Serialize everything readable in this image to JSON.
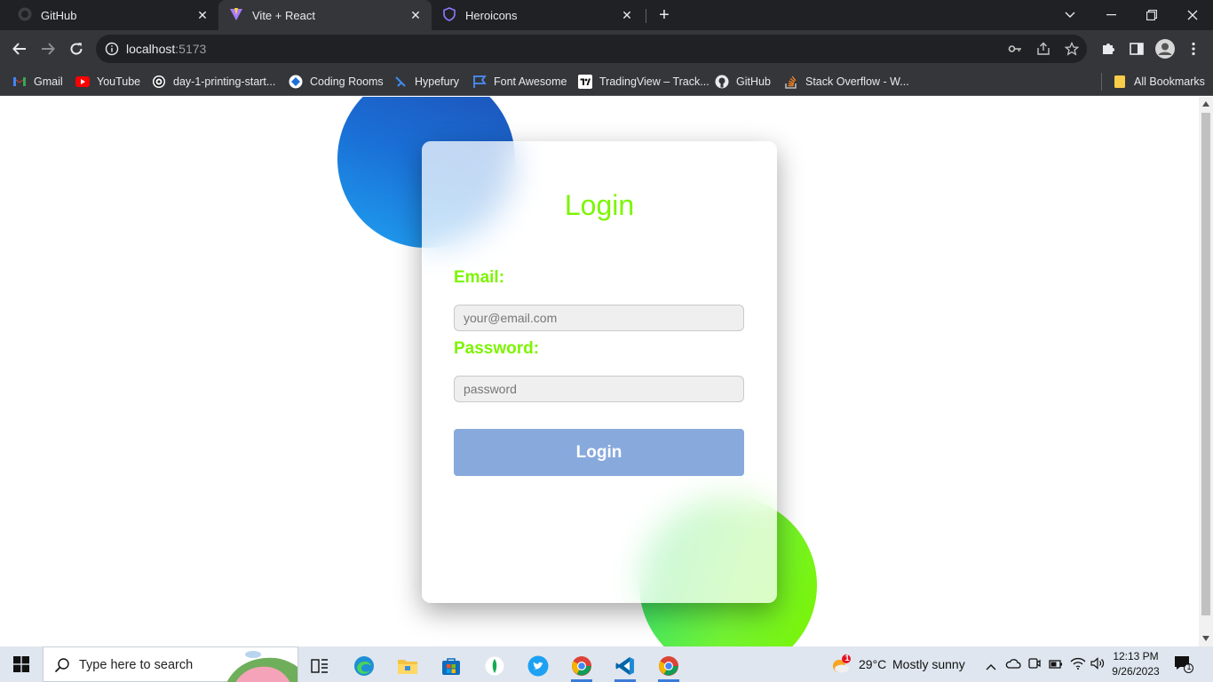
{
  "browser": {
    "tabs": [
      {
        "title": "GitHub",
        "icon": "github-icon"
      },
      {
        "title": "Vite + React",
        "icon": "vite-icon"
      },
      {
        "title": "Heroicons",
        "icon": "heroicons-icon"
      }
    ],
    "address": {
      "host": "localhost",
      "port": ":5173"
    },
    "bookmarks": [
      {
        "label": "Gmail",
        "icon": "gmail-icon"
      },
      {
        "label": "YouTube",
        "icon": "youtube-icon"
      },
      {
        "label": "day-1-printing-start...",
        "icon": "circle-icon"
      },
      {
        "label": "Coding Rooms",
        "icon": "coding-rooms-icon"
      },
      {
        "label": "Hypefury",
        "icon": "hypefury-icon"
      },
      {
        "label": "Font Awesome",
        "icon": "flag-icon"
      },
      {
        "label": "TradingView – Track...",
        "icon": "tradingview-icon"
      },
      {
        "label": "GitHub",
        "icon": "github-icon"
      },
      {
        "label": "Stack Overflow - W...",
        "icon": "stackoverflow-icon"
      }
    ],
    "all_bookmarks": "All Bookmarks"
  },
  "login": {
    "title": "Login",
    "email_label": "Email:",
    "email_placeholder": "your@email.com",
    "password_label": "Password:",
    "password_placeholder": "password",
    "submit_label": "Login"
  },
  "colors": {
    "accent_green": "#7cf500",
    "button_blue": "#87a9dc"
  },
  "taskbar": {
    "search_placeholder": "Type here to search",
    "weather": {
      "temp": "29°C",
      "condition": "Mostly sunny",
      "badge": "1"
    },
    "time": "12:13 PM",
    "date": "9/26/2023",
    "notification_count": "1"
  }
}
